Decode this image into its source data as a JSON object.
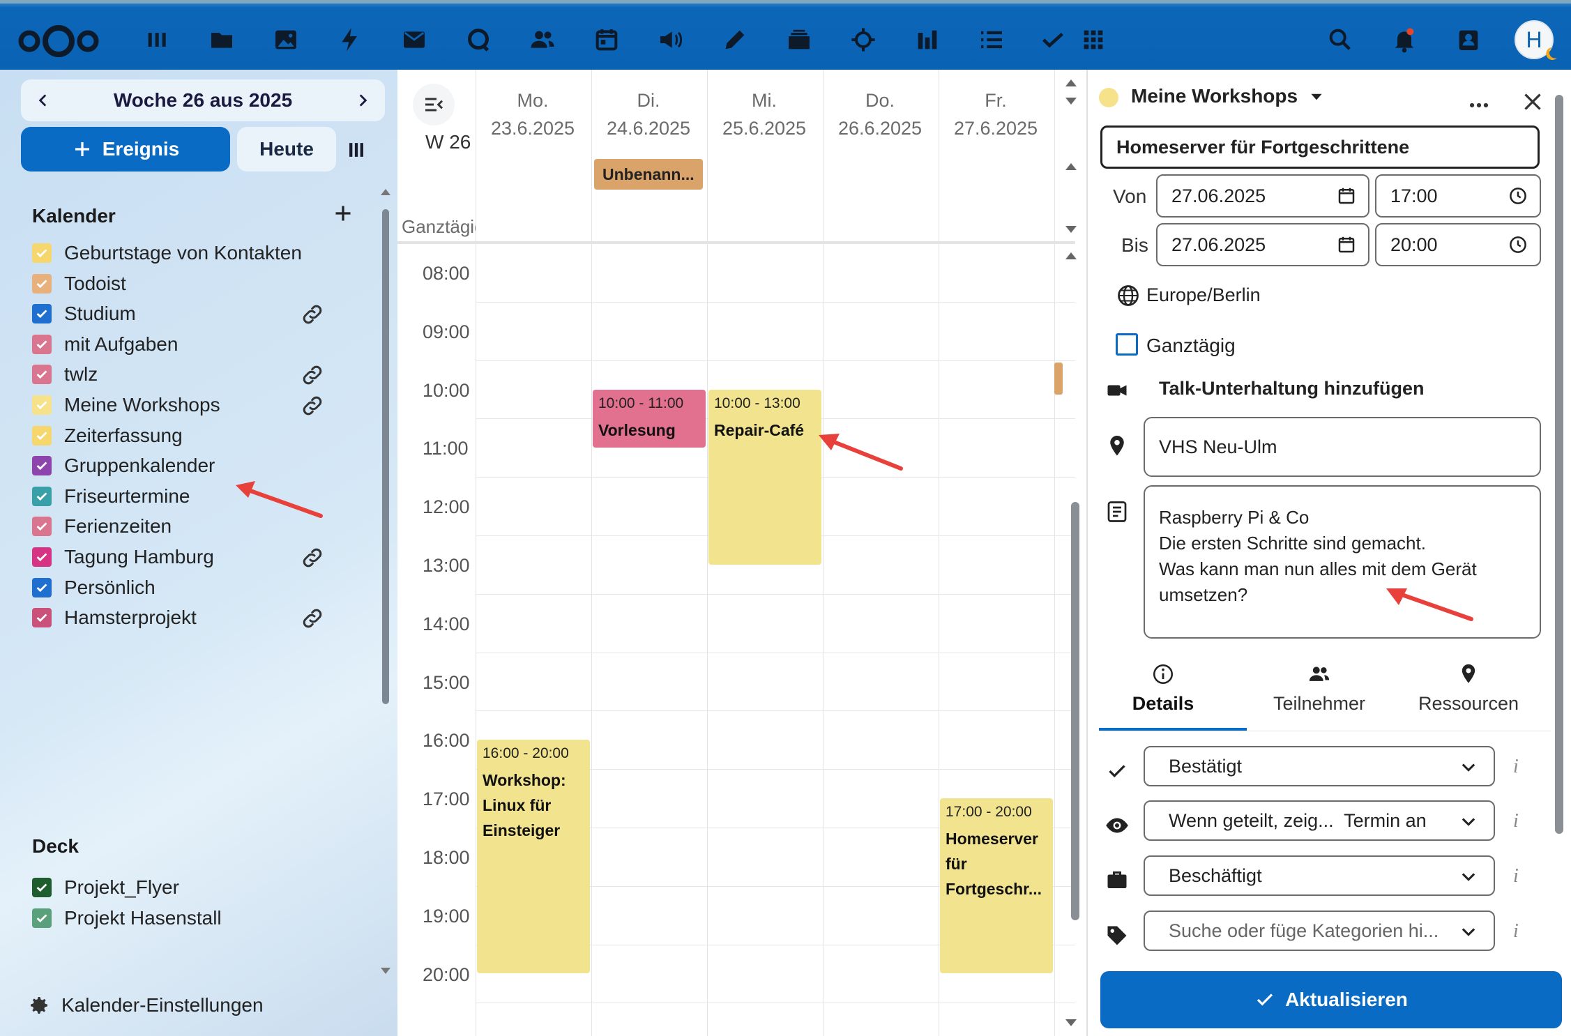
{
  "topbar": {
    "apps": [
      "dashboard-icon",
      "files-icon",
      "photos-icon",
      "activity-icon",
      "mail-icon",
      "talk-icon",
      "contacts-icon",
      "calendar-icon",
      "announcements-icon",
      "notes-icon",
      "deck-icon",
      "admin-icon",
      "analytics-icon",
      "tasks-icon",
      "checkmark-icon",
      "more-apps-icon"
    ],
    "avatar_initial": "H"
  },
  "sidebar": {
    "week_label": "Woche 26 aus 2025",
    "new_event_label": "Ereignis",
    "today_label": "Heute",
    "calendars_title": "Kalender",
    "calendars": [
      {
        "name": "Geburtstage von Kontakten",
        "color": "#f5d76e",
        "checked": true,
        "shared": false
      },
      {
        "name": "Todoist",
        "color": "#e8b07a",
        "checked": true,
        "shared": false
      },
      {
        "name": "Studium",
        "color": "#1f6fd1",
        "checked": true,
        "shared": true
      },
      {
        "name": "mit Aufgaben",
        "color": "#d9758f",
        "checked": true,
        "shared": false
      },
      {
        "name": "twlz",
        "color": "#d9758f",
        "checked": true,
        "shared": true
      },
      {
        "name": "Meine Workshops",
        "color": "#f5e28a",
        "checked": true,
        "shared": true
      },
      {
        "name": "Zeiterfassung",
        "color": "#f5d76e",
        "checked": true,
        "shared": false
      },
      {
        "name": "Gruppenkalender",
        "color": "#8e44ad",
        "checked": true,
        "shared": false
      },
      {
        "name": "Friseurtermine",
        "color": "#3aa0a8",
        "checked": true,
        "shared": false
      },
      {
        "name": "Ferienzeiten",
        "color": "#d9758f",
        "checked": true,
        "shared": false
      },
      {
        "name": "Tagung Hamburg",
        "color": "#d63384",
        "checked": true,
        "shared": true
      },
      {
        "name": "Persönlich",
        "color": "#1f6fd1",
        "checked": true,
        "shared": false
      },
      {
        "name": "Hamsterprojekt",
        "color": "#c9517a",
        "checked": true,
        "shared": true
      }
    ],
    "deck_title": "Deck",
    "decks": [
      {
        "name": "Projekt_Flyer",
        "color": "#1e5e2e",
        "checked": true
      },
      {
        "name": "Projekt Hasenstall",
        "color": "#5aa07a",
        "checked": true
      }
    ],
    "settings_label": "Kalender-Einstellungen"
  },
  "calendar": {
    "week_number": "W 26",
    "allday_label": "Ganztägig",
    "days": [
      {
        "name": "Mo.",
        "date": "23.6.2025"
      },
      {
        "name": "Di.",
        "date": "24.6.2025"
      },
      {
        "name": "Mi.",
        "date": "25.6.2025"
      },
      {
        "name": "Do.",
        "date": "26.6.2025"
      },
      {
        "name": "Fr.",
        "date": "27.6.2025"
      }
    ],
    "hours": [
      "08:00",
      "09:00",
      "10:00",
      "11:00",
      "12:00",
      "13:00",
      "14:00",
      "15:00",
      "16:00",
      "17:00",
      "18:00",
      "19:00",
      "20:00"
    ],
    "allday_events": [
      {
        "title": "Unbenann...",
        "color": "#d9a36a",
        "day": 1
      }
    ],
    "events": [
      {
        "time": "10:00 - 11:00",
        "title": "Vorlesung",
        "color": "#e2708f",
        "day": 1,
        "start": 10,
        "end": 11
      },
      {
        "time": "10:00 - 13:00",
        "title": "Repair-Café",
        "color": "#f2e48e",
        "day": 2,
        "start": 10,
        "end": 13
      },
      {
        "time": "16:00 - 20:00",
        "title": "Workshop: Linux für Einsteiger",
        "color": "#f2e48e",
        "day": 0,
        "start": 16,
        "end": 20
      },
      {
        "time": "17:00 - 20:00",
        "title": "Homeserver für Fortgeschr...",
        "color": "#f2e48e",
        "day": 4,
        "start": 17,
        "end": 20
      }
    ]
  },
  "editor": {
    "calendar_name": "Meine Workshops",
    "calendar_color": "#f5e28a",
    "title": "Homeserver für Fortgeschrittene",
    "from_label": "Von",
    "to_label": "Bis",
    "from_date": "27.06.2025",
    "from_time": "17:00",
    "to_date": "27.06.2025",
    "to_time": "20:00",
    "timezone": "Europe/Berlin",
    "allday_label": "Ganztägig",
    "allday_checked": false,
    "talk_label": "Talk-Unterhaltung hinzufügen",
    "location": "VHS Neu-Ulm",
    "description_lines": [
      "Raspberry Pi & Co",
      "Die ersten Schritte sind gemacht.",
      "Was kann man nun alles mit dem Gerät",
      "umsetzen?"
    ],
    "tabs": [
      {
        "label": "Details",
        "active": true
      },
      {
        "label": "Teilnehmer",
        "active": false
      },
      {
        "label": "Ressourcen",
        "active": false
      }
    ],
    "status": "Bestätigt",
    "visibility": "Wenn geteilt, zeig...  Termin an",
    "availability": "Beschäftigt",
    "categories_placeholder": "Suche oder füge Kategorien hi...",
    "info_glyph": "i",
    "update_label": "Aktualisieren"
  },
  "colors": {
    "accent": "#0a6bc4",
    "annotation_arrow": "#e8413c"
  }
}
